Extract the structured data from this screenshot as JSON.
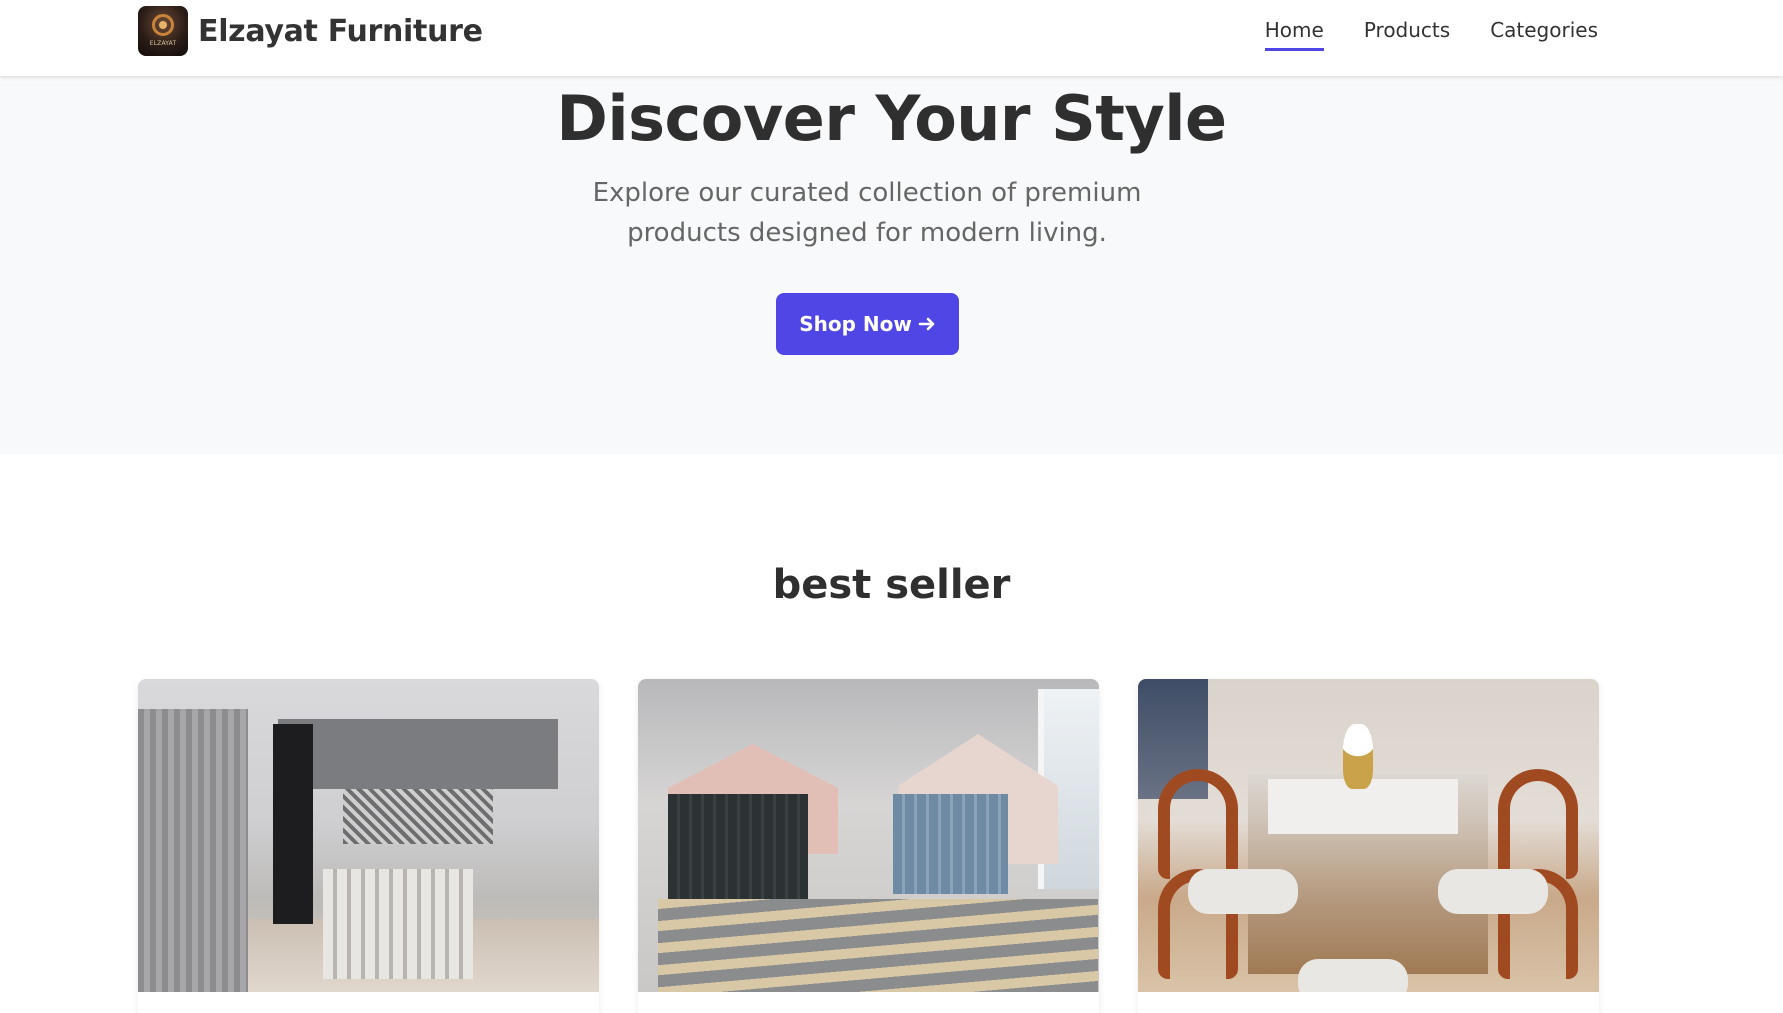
{
  "brand": {
    "name": "Elzayat Furniture",
    "logo_text": "ELZAYAT"
  },
  "nav": {
    "items": [
      {
        "label": "Home",
        "active": true
      },
      {
        "label": "Products",
        "active": false
      },
      {
        "label": "Categories",
        "active": false
      }
    ]
  },
  "hero": {
    "title": "Discover Your Style",
    "subtitle": "Explore our curated collection of premium products designed for modern living.",
    "cta_label": "Shop Now",
    "cta_icon": "arrow-right-icon"
  },
  "best_seller": {
    "title": "best seller",
    "products": [
      {
        "image": "kitchen-photo"
      },
      {
        "image": "twin-beds-photo"
      },
      {
        "image": "dining-set-photo"
      }
    ]
  },
  "colors": {
    "accent": "#4f46e5",
    "hero_background": "#f8f9fa",
    "text_dark": "#2f2f2f",
    "text_muted": "#666666"
  }
}
